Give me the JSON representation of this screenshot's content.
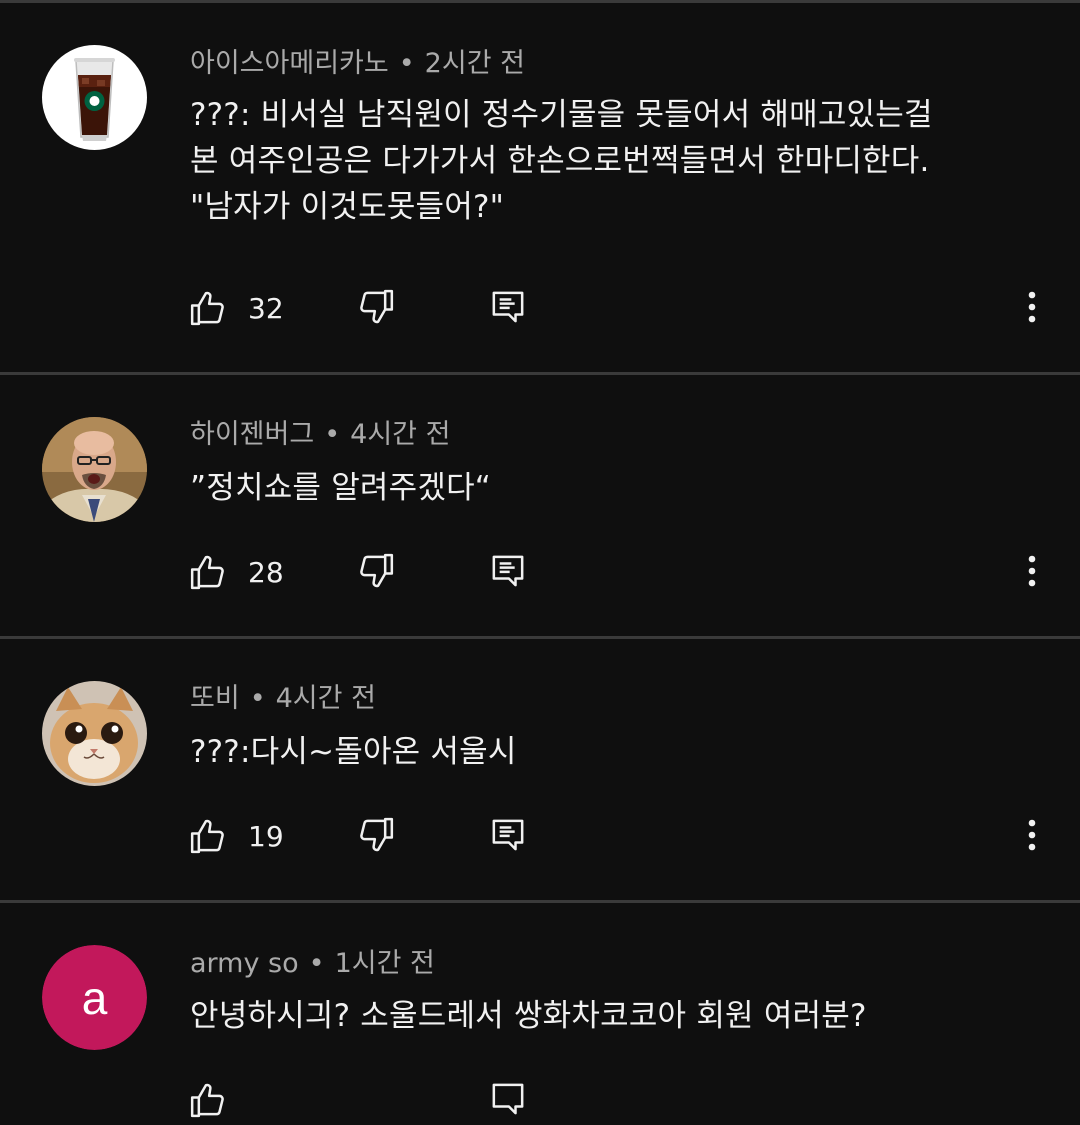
{
  "comments": [
    {
      "author": "아이스아메리카노",
      "time": "2시간 전",
      "lines": [
        "???: 비서실 남직원이 정수기물을 못들어서 해매고있는걸",
        "본 여주인공은 다가가서 한손으로번쩍들면서 한마디한다.",
        "\"남자가 이것도못들어?\""
      ],
      "likes": "32",
      "avatar_icon": "iced-coffee-avatar"
    },
    {
      "author": "하이젠버그",
      "time": "4시간 전",
      "lines": [
        "”정치쇼를 알려주겠다“"
      ],
      "likes": "28",
      "avatar_icon": "bald-man-avatar"
    },
    {
      "author": "또비",
      "time": "4시간 전",
      "lines": [
        "???:다시~돌아온 서울시"
      ],
      "likes": "19",
      "avatar_icon": "cat-avatar"
    },
    {
      "author": "army so",
      "time": "1시간 전",
      "lines": [
        "안녕하시긔? 소울드레서 쌍화차코코아 회원 여러분?"
      ],
      "avatar_letter": "a",
      "avatar_color": "#c2185b"
    }
  ],
  "meta_separator": "•",
  "colors": {
    "background": "#0f0f0f",
    "divider": "#3a3a3a",
    "meta_text": "#aaaaaa",
    "body_text": "#f1f1f1"
  }
}
